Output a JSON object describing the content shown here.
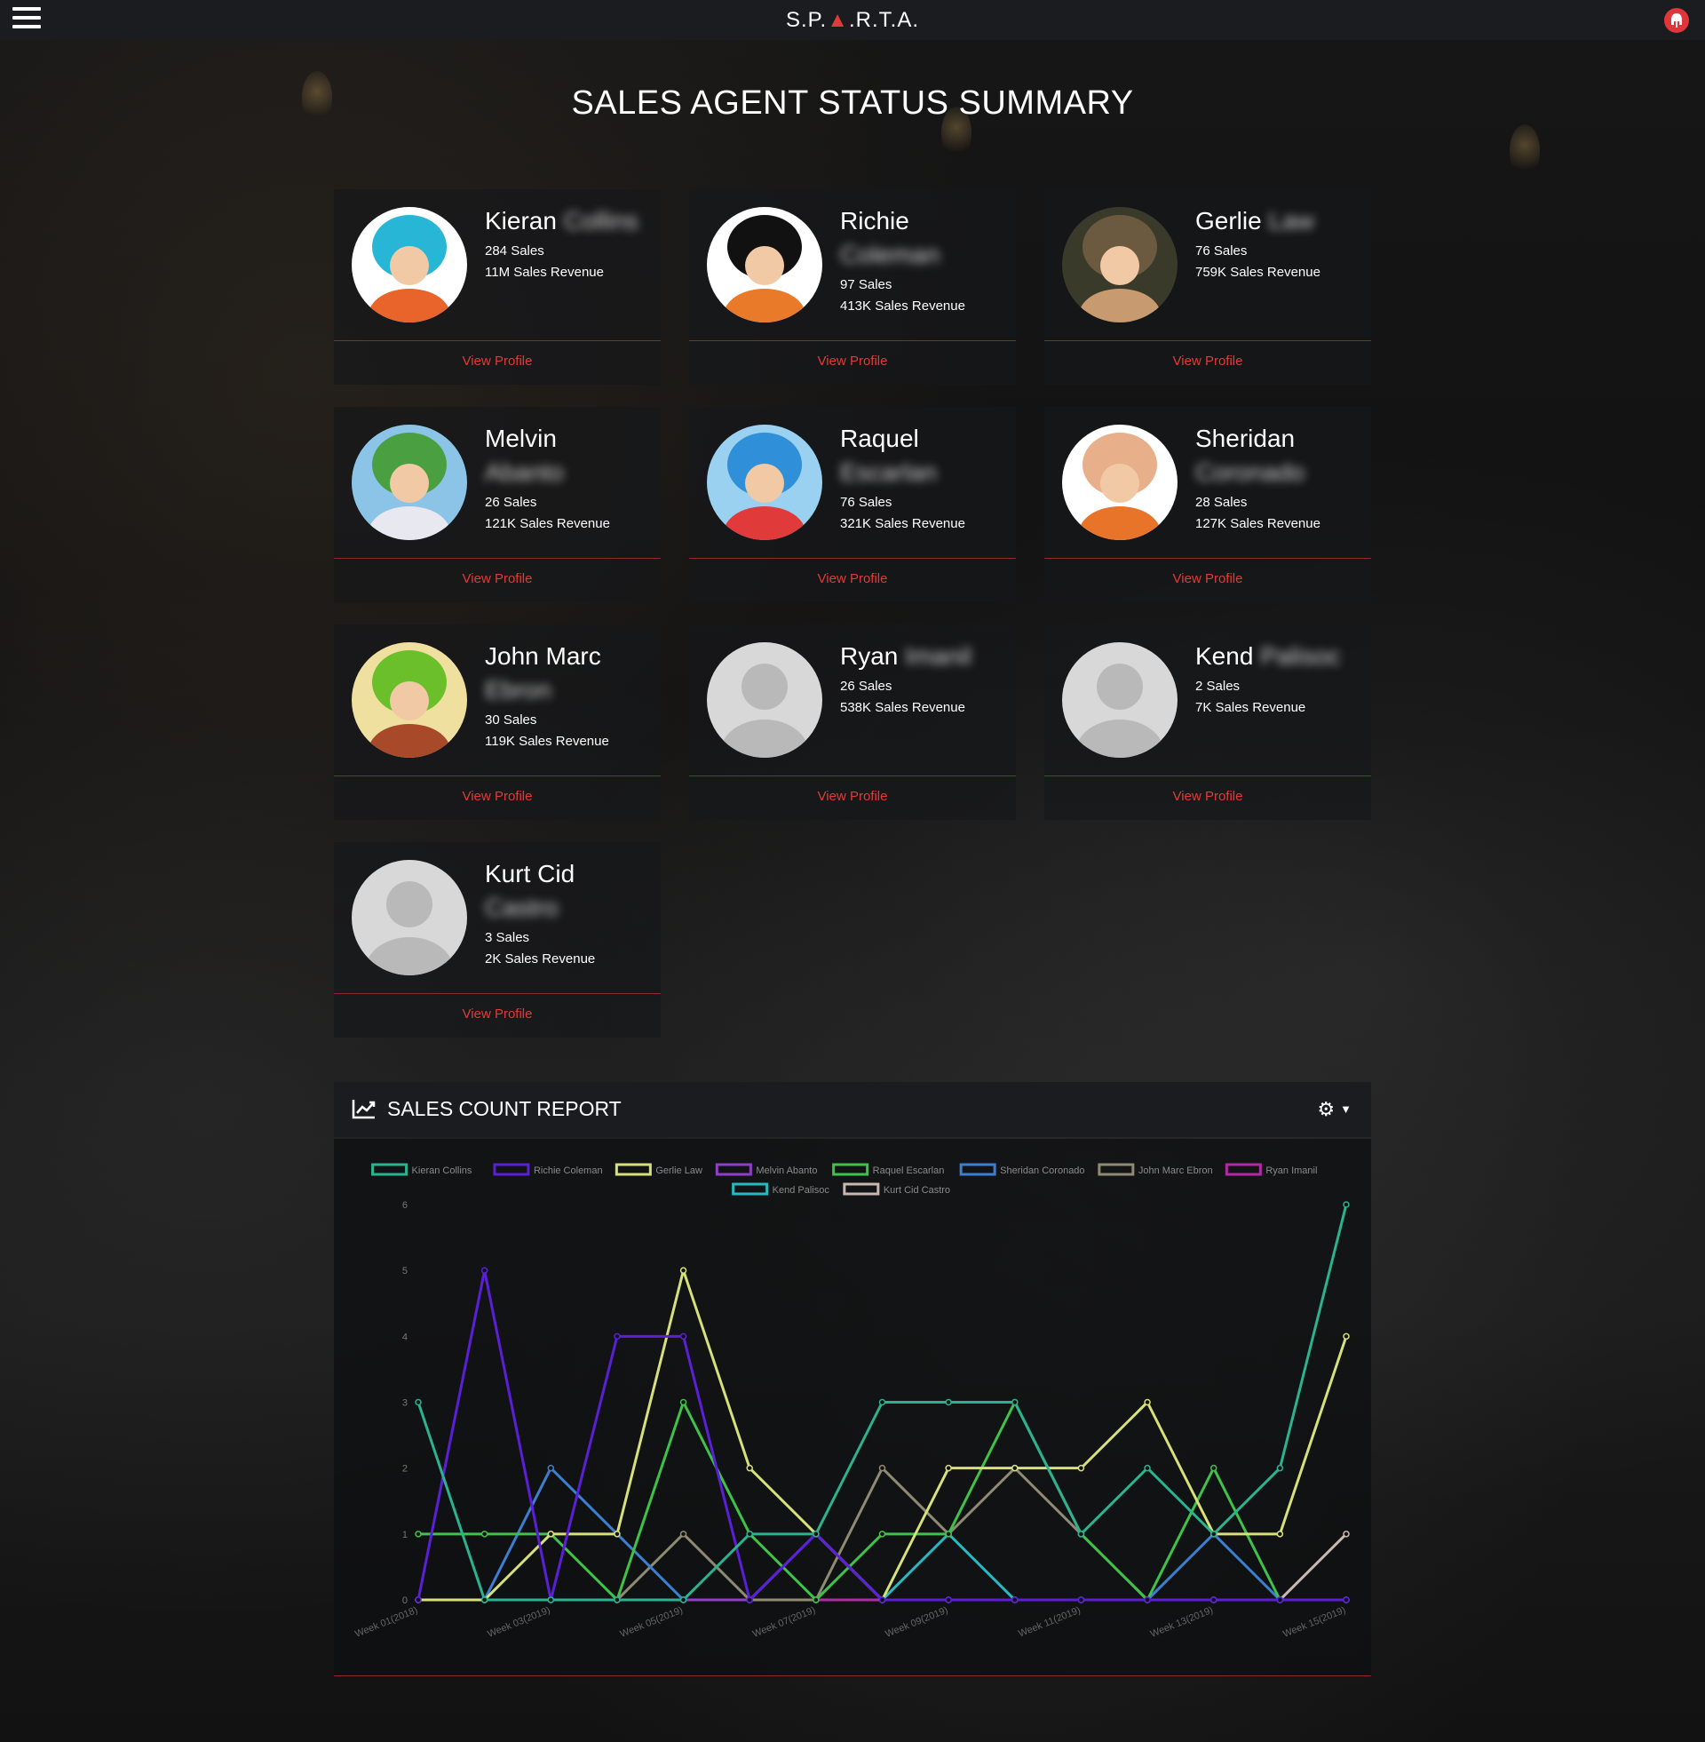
{
  "app": {
    "brand": "S.P.▲.R.T.A.",
    "brand_left": "S.P.",
    "brand_right": ".R.T.A.",
    "menu_icon": "hamburger-menu-icon",
    "logo_icon": "spartan-helmet-icon"
  },
  "page": {
    "title": "SALES AGENT STATUS SUMMARY"
  },
  "colors": {
    "accent": "#e23a3a",
    "card_bg": "#16171a",
    "topbar": "#1b1c20"
  },
  "agents": [
    {
      "first": "Kieran",
      "rest": "Collins",
      "sales": "284 Sales",
      "revenue": "11M Sales Revenue",
      "link": "View Profile",
      "avatar": "anime-avatar-blue-hair",
      "name_inline": true
    },
    {
      "first": "Richie",
      "rest": "Coleman",
      "sales": "97 Sales",
      "revenue": "413K Sales Revenue",
      "link": "View Profile",
      "avatar": "anime-avatar-black-hair",
      "name_inline": false
    },
    {
      "first": "Gerlie",
      "rest": "Law",
      "sales": "76 Sales",
      "revenue": "759K Sales Revenue",
      "link": "View Profile",
      "avatar": "photo-avatar",
      "name_inline": true
    },
    {
      "first": "Melvin",
      "rest": "Abanto",
      "sales": "26 Sales",
      "revenue": "121K Sales Revenue",
      "link": "View Profile",
      "avatar": "anime-avatar-green",
      "name_inline": false
    },
    {
      "first": "Raquel",
      "rest": "Escarlan",
      "sales": "76 Sales",
      "revenue": "321K Sales Revenue",
      "link": "View Profile",
      "avatar": "anime-avatar-blue-girl",
      "name_inline": false
    },
    {
      "first": "Sheridan",
      "rest": "Coronado",
      "sales": "28 Sales",
      "revenue": "127K Sales Revenue",
      "link": "View Profile",
      "avatar": "anime-avatar-bald",
      "name_inline": false
    },
    {
      "first": "John Marc",
      "rest": "Ebron",
      "sales": "30 Sales",
      "revenue": "119K Sales Revenue",
      "link": "View Profile",
      "avatar": "anime-avatar-green-hair",
      "name_inline": false
    },
    {
      "first": "Ryan",
      "rest": "Imanil",
      "sales": "26 Sales",
      "revenue": "538K Sales Revenue",
      "link": "View Profile",
      "avatar": "default-user-avatar",
      "name_inline": true
    },
    {
      "first": "Kend",
      "rest": "Palisoc",
      "sales": "2 Sales",
      "revenue": "7K Sales Revenue",
      "link": "View Profile",
      "avatar": "default-user-avatar",
      "name_inline": true
    },
    {
      "first": "Kurt Cid",
      "rest": "Castro",
      "sales": "3 Sales",
      "revenue": "2K Sales Revenue",
      "link": "View Profile",
      "avatar": "default-user-avatar",
      "name_inline": false
    }
  ],
  "report": {
    "title": "SALES COUNT REPORT",
    "icon": "line-chart-icon",
    "settings_icon": "gear-icon",
    "dropdown_icon": "caret-down-icon"
  },
  "chart_data": {
    "type": "line",
    "x_tick_labels": [
      "Week 01(2018)",
      "Week 03(2019)",
      "Week 05(2019)",
      "Week 07(2019)",
      "Week 09(2019)",
      "Week 11(2019)",
      "Week 13(2019)",
      "Week 15(2019)"
    ],
    "x_count": 15,
    "ylim": [
      0,
      6
    ],
    "y_ticks": [
      0,
      1,
      2,
      3,
      4,
      5,
      6
    ],
    "legend_position": "top",
    "series": [
      {
        "name": "Kieran Collins",
        "color": "#2bb38f",
        "values": [
          3,
          0,
          0,
          0,
          0,
          1,
          1,
          3,
          3,
          3,
          1,
          2,
          1,
          2,
          6
        ]
      },
      {
        "name": "Richie Coleman",
        "color": "#5a1fd6",
        "values": [
          0,
          5,
          0,
          4,
          4,
          0,
          1,
          0,
          0,
          0,
          0,
          0,
          0,
          0,
          0
        ]
      },
      {
        "name": "Gerlie Law",
        "color": "#d8e07a",
        "values": [
          0,
          0,
          1,
          1,
          5,
          2,
          1,
          0,
          2,
          2,
          2,
          3,
          1,
          1,
          4
        ]
      },
      {
        "name": "Melvin Abanto",
        "color": "#8e3fc8",
        "values": [
          0,
          0,
          0,
          0,
          0,
          0,
          1,
          0,
          0,
          0,
          0,
          0,
          0,
          0,
          0
        ]
      },
      {
        "name": "Raquel Escarlan",
        "color": "#3fc24a",
        "values": [
          1,
          1,
          1,
          0,
          3,
          1,
          0,
          1,
          1,
          3,
          1,
          0,
          2,
          0,
          0
        ]
      },
      {
        "name": "Sheridan Coronado",
        "color": "#3c7fd0",
        "values": [
          0,
          0,
          2,
          1,
          0,
          0,
          1,
          0,
          0,
          0,
          0,
          0,
          1,
          0,
          0
        ]
      },
      {
        "name": "John Marc Ebron",
        "color": "#8f8a74",
        "values": [
          0,
          0,
          0,
          0,
          1,
          0,
          0,
          2,
          1,
          2,
          1,
          0,
          0,
          0,
          0
        ]
      },
      {
        "name": "Ryan Imanil",
        "color": "#b12aa6",
        "values": [
          0,
          0,
          0,
          0,
          0,
          0,
          0,
          0,
          0,
          0,
          0,
          0,
          0,
          0,
          0
        ]
      },
      {
        "name": "Kend Palisoc",
        "color": "#2ab8c0",
        "values": [
          0,
          0,
          0,
          0,
          0,
          0,
          0,
          0,
          1,
          0,
          0,
          0,
          0,
          0,
          0
        ]
      },
      {
        "name": "Kurt Cid Castro",
        "color": "#c9b8b2",
        "values": [
          0,
          0,
          0,
          0,
          0,
          0,
          0,
          0,
          0,
          0,
          0,
          0,
          0,
          0,
          1
        ]
      }
    ]
  }
}
